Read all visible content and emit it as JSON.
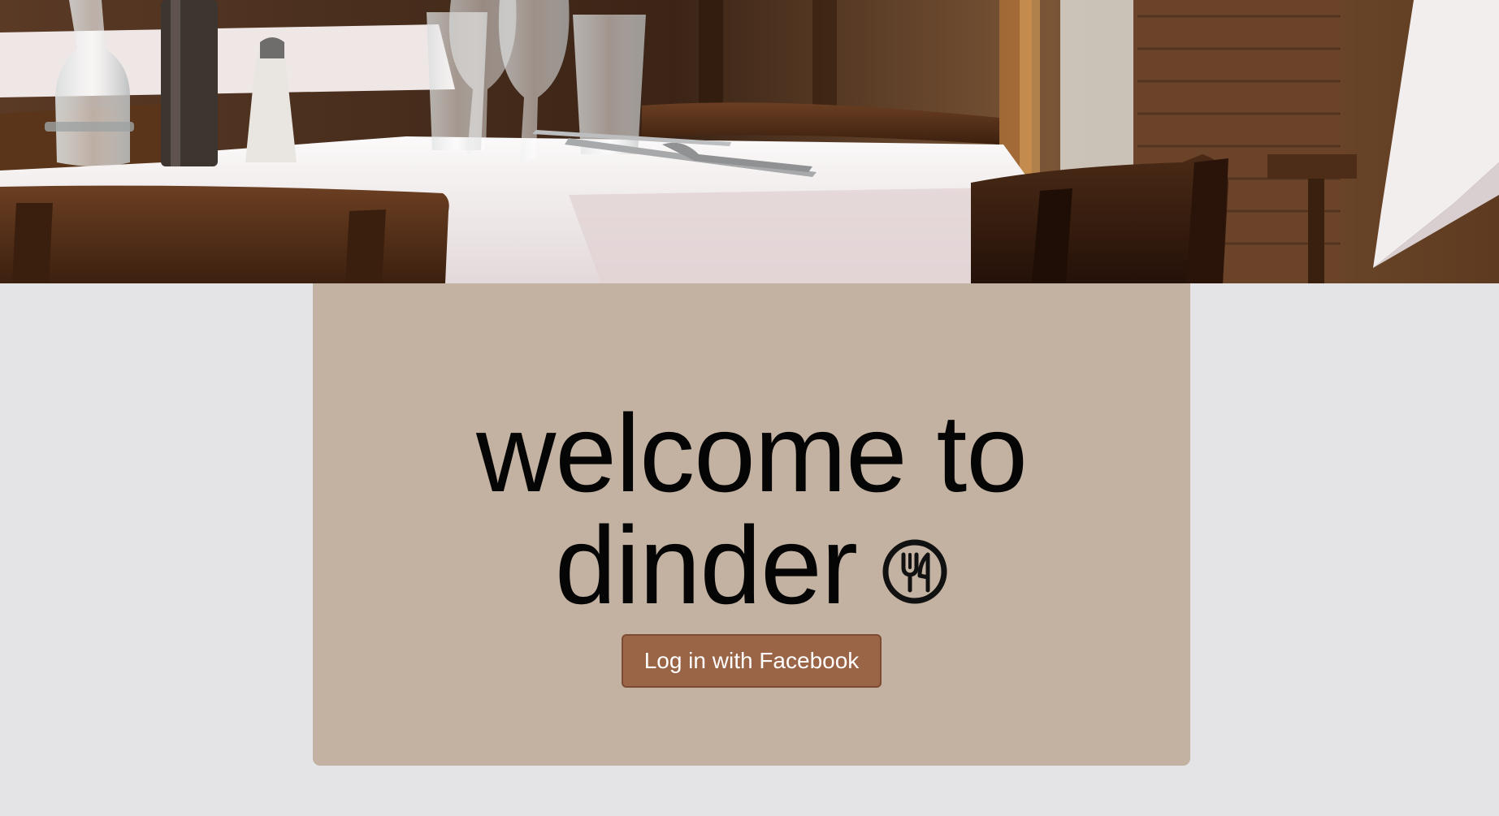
{
  "hero": {
    "image_icon": "restaurant-table-photo"
  },
  "welcome": {
    "title_line_1": "welcome to",
    "title_line_2": "dinder",
    "title_icon": "fork-knife-circle-icon"
  },
  "actions": {
    "facebook_login_label": "Log in with Facebook"
  },
  "colors": {
    "page_background": "#e4e4e6",
    "card_background": "#c3b2a1",
    "button_background": "#9a6446",
    "button_text": "#ffffff",
    "title_text": "#050505"
  }
}
